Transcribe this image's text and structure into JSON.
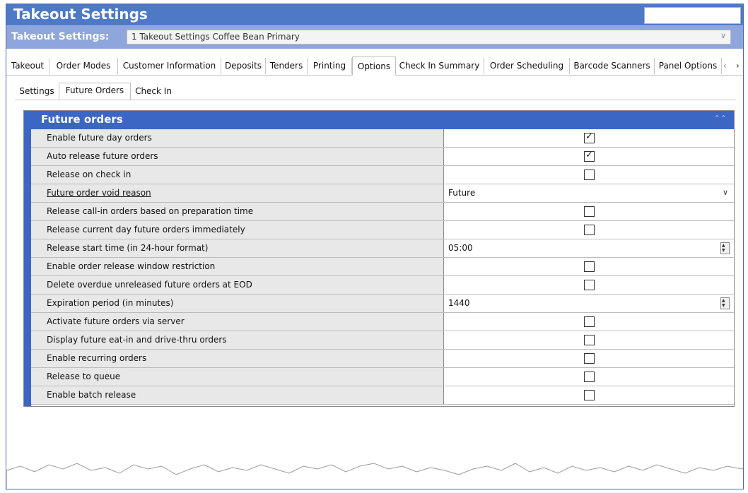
{
  "window": {
    "title": "Takeout Settings",
    "selector_label": "Takeout Settings:",
    "selector_value": "1 Takeout Settings Coffee Bean Primary"
  },
  "tabs": [
    {
      "label": "Takeout"
    },
    {
      "label": "Order Modes"
    },
    {
      "label": "Customer Information"
    },
    {
      "label": "Deposits"
    },
    {
      "label": "Tenders"
    },
    {
      "label": "Printing"
    },
    {
      "label": "Options",
      "active": true
    },
    {
      "label": "Check In Summary"
    },
    {
      "label": "Order Scheduling"
    },
    {
      "label": "Barcode Scanners"
    },
    {
      "label": "Panel Options"
    }
  ],
  "subtabs": [
    {
      "label": "Settings"
    },
    {
      "label": "Future Orders",
      "active": true
    },
    {
      "label": "Check In"
    }
  ],
  "section": {
    "title": "Future orders",
    "rows": [
      {
        "label": "Enable future day orders",
        "type": "checkbox",
        "checked": true
      },
      {
        "label": "Auto release future orders",
        "type": "checkbox",
        "checked": true
      },
      {
        "label": "Release on check in",
        "type": "checkbox",
        "checked": false
      },
      {
        "label": "Future order void reason",
        "type": "dropdown",
        "value": "Future"
      },
      {
        "label": "Release call-in orders based on preparation time",
        "type": "checkbox",
        "checked": false
      },
      {
        "label": "Release current day future orders immediately",
        "type": "checkbox",
        "checked": false
      },
      {
        "label": "Release start time (in 24-hour format)",
        "type": "spinner",
        "value": "05:00"
      },
      {
        "label": "Enable order release window restriction",
        "type": "checkbox",
        "checked": false
      },
      {
        "label": "Delete overdue unreleased future orders at EOD",
        "type": "checkbox",
        "checked": false
      },
      {
        "label": "Expiration period (in minutes)",
        "type": "spinner",
        "value": "1440"
      },
      {
        "label": "Activate future orders via server",
        "type": "checkbox",
        "checked": false
      },
      {
        "label": "Display future eat-in and drive-thru orders",
        "type": "checkbox",
        "checked": false
      },
      {
        "label": "Enable recurring orders",
        "type": "checkbox",
        "checked": false
      },
      {
        "label": "Release to queue",
        "type": "checkbox",
        "checked": false
      },
      {
        "label": "Enable batch release",
        "type": "checkbox",
        "checked": false
      }
    ]
  },
  "icons": {
    "collapse": "chevron-double-up-icon",
    "dropdown": "chevron-down-icon",
    "tab_scroll_left": "chevron-left-icon",
    "tab_scroll_right": "chevron-right-icon",
    "spinner": "spinner-icon",
    "checkmark": "checkmark-icon"
  },
  "colors": {
    "title_bar": "#4d79c7",
    "selector_bar": "#8fa6dc",
    "section_header": "#3c66c4",
    "label_cell": "#e8e8e8"
  }
}
